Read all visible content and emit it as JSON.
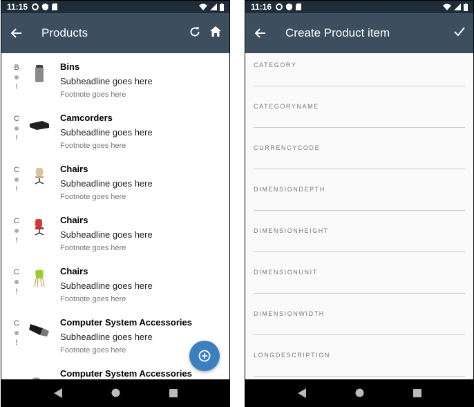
{
  "left": {
    "status": {
      "time": "11:15"
    },
    "toolbar": {
      "title": "Products",
      "back_icon": "arrow-left-icon",
      "refresh_icon": "refresh-icon",
      "home_icon": "home-icon"
    },
    "items": [
      {
        "initial": "B",
        "mark": "!",
        "title": "Bins",
        "subtitle": "Subheadline goes here",
        "footnote": "Footnote goes here",
        "thumb": "bin-image"
      },
      {
        "initial": "C",
        "mark": "!",
        "title": "Camcorders",
        "subtitle": "Subheadline goes here",
        "footnote": "Footnote goes here",
        "thumb": "camcorder-image"
      },
      {
        "initial": "C",
        "mark": "!",
        "title": "Chairs",
        "subtitle": "Subheadline goes here",
        "footnote": "Footnote goes here",
        "thumb": "chair-beige-image"
      },
      {
        "initial": "C",
        "mark": "!",
        "title": "Chairs",
        "subtitle": "Subheadline goes here",
        "footnote": "Footnote goes here",
        "thumb": "chair-red-image"
      },
      {
        "initial": "C",
        "mark": "!",
        "title": "Chairs",
        "subtitle": "Subheadline goes here",
        "footnote": "Footnote goes here",
        "thumb": "chair-green-image"
      },
      {
        "initial": "C",
        "mark": "!",
        "title": "Computer System Accessories",
        "subtitle": "Subheadline goes here",
        "footnote": "Footnote goes here",
        "thumb": "usb-stick-image"
      },
      {
        "initial": "",
        "mark": "",
        "title": "Computer System Accessories",
        "subtitle": "",
        "footnote": "",
        "thumb": "cable-image"
      }
    ],
    "fab_icon": "add-circle-icon"
  },
  "right": {
    "status": {
      "time": "11:16"
    },
    "toolbar": {
      "title": "Create Product item",
      "back_icon": "arrow-left-icon",
      "confirm_icon": "check-icon"
    },
    "fields": [
      {
        "label": "CATEGORY",
        "value": ""
      },
      {
        "label": "CATEGORYNAME",
        "value": ""
      },
      {
        "label": "CURRENCYCODE",
        "value": ""
      },
      {
        "label": "DIMENSIONDEPTH",
        "value": ""
      },
      {
        "label": "DIMENSIONHEIGHT",
        "value": ""
      },
      {
        "label": "DIMENSIONUNIT",
        "value": ""
      },
      {
        "label": "DIMENSIONWIDTH",
        "value": ""
      },
      {
        "label": "LONGDESCRIPTION",
        "value": ""
      }
    ]
  },
  "colors": {
    "toolbar": "#3d4e5f",
    "statusbar": "#1f2d3a",
    "fab": "#3c7fc0"
  }
}
